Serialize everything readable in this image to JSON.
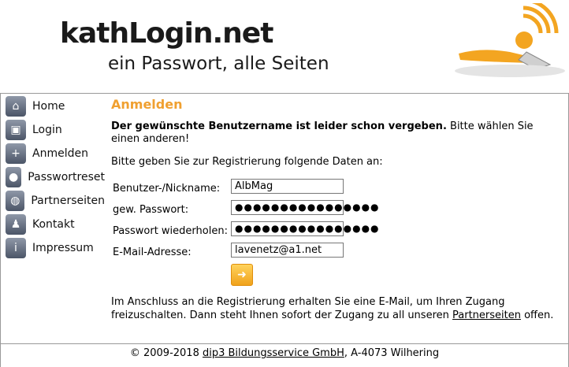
{
  "header": {
    "logo": "kathLogin.net",
    "tagline": "ein Passwort, alle Seiten"
  },
  "sidebar": {
    "items": [
      {
        "label": "Home",
        "icon": "home-icon"
      },
      {
        "label": "Login",
        "icon": "lock-icon"
      },
      {
        "label": "Anmelden",
        "icon": "add-user-icon"
      },
      {
        "label": "Passwortreset",
        "icon": "lightbulb-icon"
      },
      {
        "label": "Partnerseiten",
        "icon": "globe-icon"
      },
      {
        "label": "Kontakt",
        "icon": "person-icon"
      },
      {
        "label": "Impressum",
        "icon": "info-icon"
      }
    ]
  },
  "main": {
    "title": "Anmelden",
    "error_bold": "Der gewünschte Benutzername ist leider schon vergeben.",
    "error_rest": " Bitte wählen Sie einen anderen!",
    "intro": "Bitte geben Sie zur Registrierung folgende Daten an:",
    "form": {
      "username_label": "Benutzer-/Nickname:",
      "username_value": "AlbMag",
      "password_label": "gew. Passwort:",
      "password_value": "●●●●●●●●●●●●●●●●",
      "password2_label": "Passwort wiederholen:",
      "password2_value": "●●●●●●●●●●●●●●●●",
      "email_label": "E-Mail-Adresse:",
      "email_value": "lavenetz@a1.net"
    },
    "info_text_1": "Im Anschluss an die Registrierung erhalten Sie eine E-Mail, um Ihren Zugang freizuschalten. Dann steht Ihnen sofort der Zugang zu all unseren ",
    "info_link": "Partnerseiten",
    "info_text_2": " offen."
  },
  "footer": {
    "prefix": "© 2009-2018 ",
    "company_link": "dip3 Bildungsservice GmbH",
    "suffix": ", A-4073 Wilhering"
  },
  "colors": {
    "accent": "#f0a030"
  }
}
